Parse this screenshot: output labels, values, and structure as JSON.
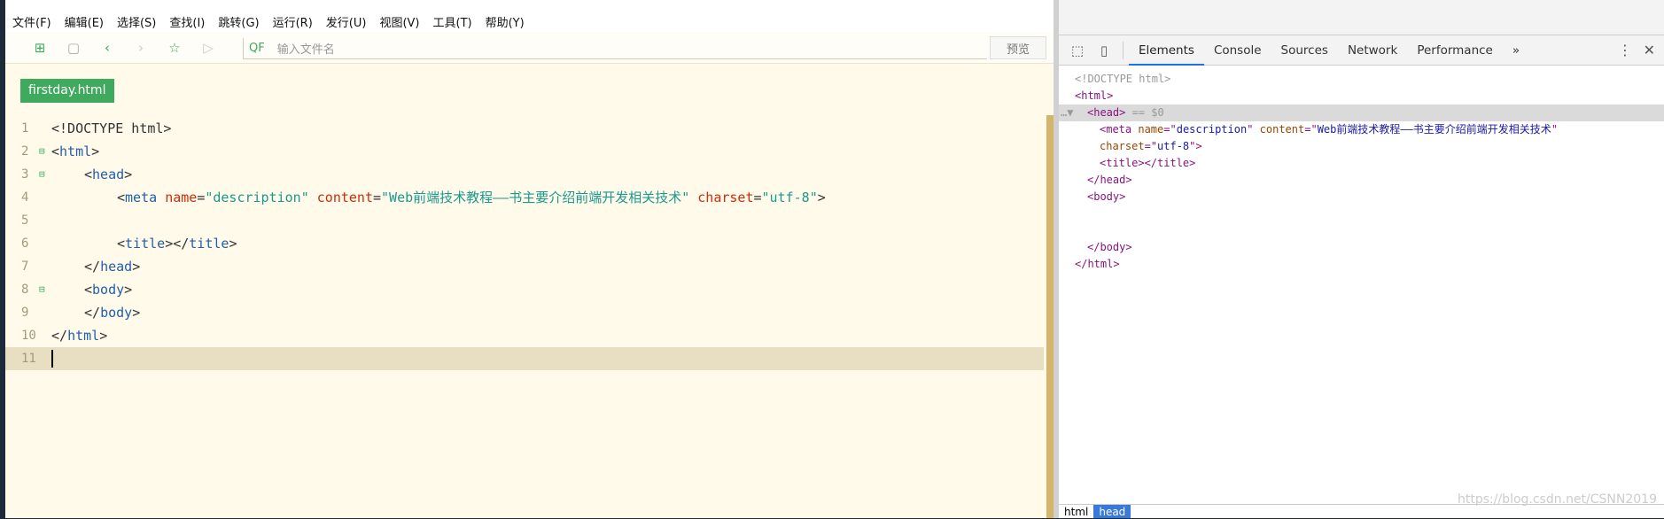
{
  "menu": [
    "文件(F)",
    "编辑(E)",
    "选择(S)",
    "查找(I)",
    "跳转(G)",
    "运行(R)",
    "发行(U)",
    "视图(V)",
    "工具(T)",
    "帮助(Y)"
  ],
  "toolbar": {
    "search_placeholder": "输入文件名",
    "search_prefix": "QF",
    "preview_label": "预览"
  },
  "file_tab": "firstday.html",
  "code_lines": [
    {
      "n": "1",
      "fold": "",
      "indent": 0,
      "parts": [
        [
          "pl",
          "<!DOCTYPE html>"
        ]
      ]
    },
    {
      "n": "2",
      "fold": "⊟",
      "indent": 0,
      "parts": [
        [
          "pl",
          "<"
        ],
        [
          "tg",
          "html"
        ],
        [
          "pl",
          ">"
        ]
      ]
    },
    {
      "n": "3",
      "fold": "⊟",
      "indent": 1,
      "parts": [
        [
          "pl",
          "<"
        ],
        [
          "tg",
          "head"
        ],
        [
          "pl",
          ">"
        ]
      ]
    },
    {
      "n": "4",
      "fold": "",
      "indent": 2,
      "parts": [
        [
          "pl",
          "<"
        ],
        [
          "tg",
          "meta "
        ],
        [
          "at",
          "name"
        ],
        [
          "pl",
          "="
        ],
        [
          "st",
          "\"description\" "
        ],
        [
          "at",
          "content"
        ],
        [
          "pl",
          "="
        ],
        [
          "st",
          "\"Web前端技术教程——书主要介绍前端开发相关技术\" "
        ],
        [
          "at",
          "charset"
        ],
        [
          "pl",
          "="
        ],
        [
          "st",
          "\"utf-8\""
        ],
        [
          "pl",
          ">"
        ]
      ]
    },
    {
      "n": "5",
      "fold": "",
      "indent": 0,
      "parts": []
    },
    {
      "n": "6",
      "fold": "",
      "indent": 2,
      "parts": [
        [
          "pl",
          "<"
        ],
        [
          "tg",
          "title"
        ],
        [
          "pl",
          "></"
        ],
        [
          "tg",
          "title"
        ],
        [
          "pl",
          ">"
        ]
      ]
    },
    {
      "n": "7",
      "fold": "",
      "indent": 1,
      "parts": [
        [
          "pl",
          "</"
        ],
        [
          "tg",
          "head"
        ],
        [
          "pl",
          ">"
        ]
      ]
    },
    {
      "n": "8",
      "fold": "⊟",
      "indent": 1,
      "parts": [
        [
          "pl",
          "<"
        ],
        [
          "tg",
          "body"
        ],
        [
          "pl",
          ">"
        ]
      ]
    },
    {
      "n": "9",
      "fold": "",
      "indent": 1,
      "parts": [
        [
          "pl",
          "</"
        ],
        [
          "tg",
          "body"
        ],
        [
          "pl",
          ">"
        ]
      ]
    },
    {
      "n": "10",
      "fold": "",
      "indent": 0,
      "parts": [
        [
          "pl",
          "</"
        ],
        [
          "tg",
          "html"
        ],
        [
          "pl",
          ">"
        ]
      ]
    },
    {
      "n": "11",
      "fold": "",
      "indent": 0,
      "parts": []
    }
  ],
  "devtools": {
    "tabs": [
      "Elements",
      "Console",
      "Sources",
      "Network",
      "Performance"
    ],
    "active_tab": "Elements",
    "more": "»",
    "dom": [
      {
        "indent": 0,
        "parts": [
          [
            "dg",
            "<!DOCTYPE html>"
          ]
        ]
      },
      {
        "indent": 0,
        "parts": [
          [
            "dt",
            "<html>"
          ]
        ]
      },
      {
        "indent": 1,
        "sel": true,
        "parts": [
          [
            "dt",
            "<head>"
          ],
          [
            "dg",
            " == $0"
          ]
        ]
      },
      {
        "indent": 2,
        "parts": [
          [
            "dt",
            "<meta "
          ],
          [
            "da",
            "name"
          ],
          [
            "dt",
            "=\""
          ],
          [
            "dv",
            "description"
          ],
          [
            "dt",
            "\" "
          ],
          [
            "da",
            "content"
          ],
          [
            "dt",
            "=\""
          ],
          [
            "dv",
            "Web前端技术教程——书主要介绍前端开发相关技术"
          ],
          [
            "dt",
            "\""
          ]
        ]
      },
      {
        "indent": 2,
        "parts": [
          [
            "da",
            "charset"
          ],
          [
            "dt",
            "=\""
          ],
          [
            "dv",
            "utf-8"
          ],
          [
            "dt",
            "\">"
          ]
        ]
      },
      {
        "indent": 2,
        "parts": [
          [
            "dt",
            "<title></title>"
          ]
        ]
      },
      {
        "indent": 1,
        "parts": [
          [
            "dt",
            "</head>"
          ]
        ]
      },
      {
        "indent": 1,
        "parts": [
          [
            "dt",
            "<body>"
          ]
        ]
      },
      {
        "indent": 0,
        "parts": []
      },
      {
        "indent": 0,
        "parts": []
      },
      {
        "indent": 1,
        "parts": [
          [
            "dt",
            "</body>"
          ]
        ]
      },
      {
        "indent": 0,
        "parts": [
          [
            "dt",
            "</html>"
          ]
        ]
      }
    ],
    "breadcrumbs": [
      "html",
      "head"
    ],
    "active_crumb": "head"
  },
  "watermark": "https://blog.csdn.net/CSNN2019"
}
